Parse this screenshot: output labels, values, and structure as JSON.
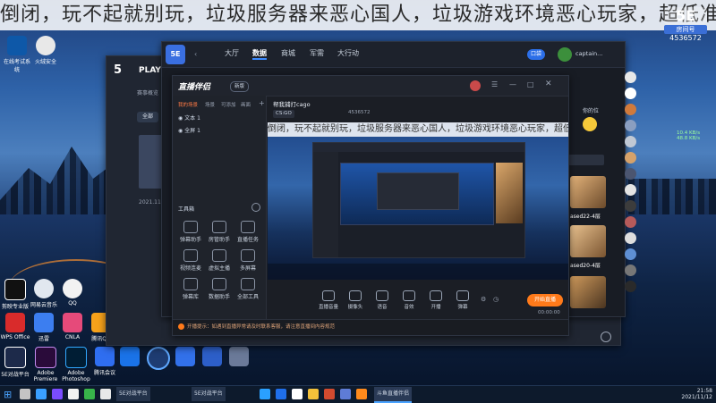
{
  "banner": {
    "text": "倒闭，玩不起就别玩，垃圾服务器来恶心国人，垃圾游戏环境恶心玩家，超低准入"
  },
  "room": {
    "big": "5E",
    "label": "房间号",
    "number": "4536572"
  },
  "desktop_icons": [
    {
      "label": "在线考试系统"
    },
    {
      "label": "火绒安全"
    },
    {
      "label": "剪映专业版"
    },
    {
      "label": "网易云音乐"
    },
    {
      "label": "QQ"
    },
    {
      "label": "WPS Office"
    },
    {
      "label": "迅雷"
    },
    {
      "label": "CNLA"
    },
    {
      "label": "腾讯QQ"
    },
    {
      "label": "5E对战平台"
    },
    {
      "label": "Adobe Premiere"
    },
    {
      "label": "Adobe Photoshop"
    },
    {
      "label": "腾讯会议"
    }
  ],
  "taskbar": {
    "items": [
      "5E对战平台",
      "5E对战平台",
      "斗鱼直播伴侣"
    ],
    "time": "21:58",
    "date": "2021/11/12"
  },
  "play_window": {
    "brand": "PLAY",
    "nav1": "赛事概览",
    "chip": "全部",
    "date_text": "2021.11"
  },
  "client": {
    "logo": "5E",
    "tabs": [
      "大厅",
      "数据",
      "商城",
      "军需",
      "大行动"
    ],
    "active_tab": "数据",
    "user": "captain...",
    "btn_label": "口袋",
    "right_label": "你的位"
  },
  "stream": {
    "title": "直播伴侣",
    "tag": "新版",
    "side_tabs": [
      "我的场景",
      "场景",
      "可添加",
      "画面"
    ],
    "scenes": [
      "文本 1",
      "全屏 1"
    ],
    "section": "工具箱",
    "tools": [
      "弹幕助手",
      "房管助手",
      "直播任务",
      "视频连麦",
      "虚拟主播",
      "多屏幕",
      "弹幕库",
      "数据助手",
      "全部工具"
    ],
    "room_title": "帮我捕打cago",
    "game_tag": "CS:GO",
    "stats": "4536572",
    "marquee": "倒闭，玩不起就别玩，垃圾服务器来恶心国人，垃圾游戏环境恶心玩家，超低准入",
    "footer_tools": [
      "直播音量",
      "摄像头",
      "语音",
      "音效",
      "开播",
      "弹幕"
    ],
    "go_live": "开始直播",
    "timer": "00:00:00",
    "notice": "开播提示：如遇到直播异常请及时联系客服，请注意直播间内容规范"
  },
  "speed": {
    "up": "10.4 KB/s",
    "down": "48.8 KB/s"
  },
  "right_panel": {
    "tabs": [
      "最近",
      "好友"
    ],
    "cards": [
      "ased22-4层",
      "ased20-4层"
    ]
  }
}
